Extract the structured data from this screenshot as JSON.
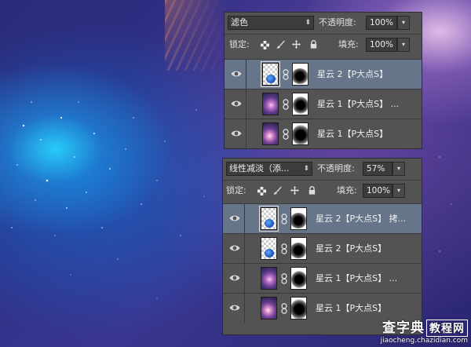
{
  "panel_top": {
    "blend_mode": "滤色",
    "opacity_label": "不透明度:",
    "opacity_value": "100%",
    "lock_label": "锁定:",
    "fill_label": "填充:",
    "fill_value": "100%",
    "layers": [
      {
        "name": "星云 2【P大点S】",
        "active": true
      },
      {
        "name": "星云 1【P大点S】 ...",
        "active": false
      },
      {
        "name": "星云 1【P大点S】",
        "active": false
      }
    ]
  },
  "panel_bottom": {
    "blend_mode": "线性减淡（添...",
    "opacity_label": "不透明度:",
    "opacity_value": "57%",
    "lock_label": "锁定:",
    "fill_label": "填充:",
    "fill_value": "100%",
    "layers": [
      {
        "name": "星云 2【P大点S】 拷...",
        "active": true
      },
      {
        "name": "星云 2【P大点S】",
        "active": false
      },
      {
        "name": "星云 1【P大点S】 ...",
        "active": false
      },
      {
        "name": "星云 1【P大点S】",
        "active": false
      }
    ]
  },
  "watermark": {
    "line1_a": "查字典",
    "line1_b": "教程网",
    "line2": "jiaocheng.chazidian.com"
  },
  "icons": [
    "eye-icon",
    "lock-transparent-icon",
    "brush-icon",
    "move-icon",
    "lock-icon",
    "chain-icon",
    "dropdown-caret-icon"
  ]
}
